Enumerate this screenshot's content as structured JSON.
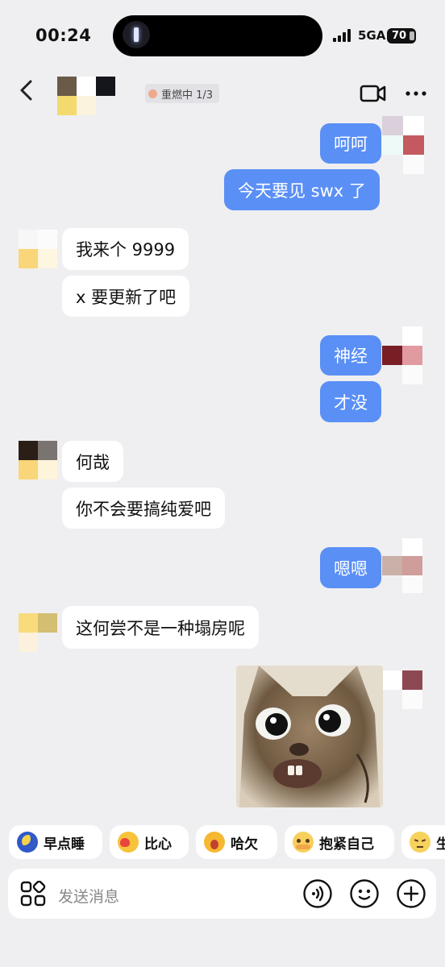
{
  "status_bar": {
    "time": "00:24",
    "network": "5GA",
    "battery": "70"
  },
  "header": {
    "group_status": "重燃中 1/3"
  },
  "messages": [
    {
      "side": "me",
      "text": "呵呵"
    },
    {
      "side": "me",
      "text": "今天要见 swx 了"
    },
    {
      "side": "other",
      "text": "我来个 9999"
    },
    {
      "side": "other",
      "text": "x 要更新了吧"
    },
    {
      "side": "me",
      "text": "神经"
    },
    {
      "side": "me",
      "text": "才没"
    },
    {
      "side": "other",
      "text": "何哉"
    },
    {
      "side": "other",
      "text": "你不会要搞纯爱吧"
    },
    {
      "side": "me",
      "text": "嗯嗯"
    },
    {
      "side": "other",
      "text": "这何尝不是一种塌房呢"
    },
    {
      "side": "me",
      "type": "sticker"
    }
  ],
  "quick_replies": [
    {
      "emoji": "moon-icon",
      "label": "早点睡"
    },
    {
      "emoji": "heart-hands-icon",
      "label": "比心"
    },
    {
      "emoji": "yawn-icon",
      "label": "哈欠"
    },
    {
      "emoji": "self-hug-icon",
      "label": "抱紧自己"
    },
    {
      "emoji": "angry-face-icon",
      "label": "生"
    }
  ],
  "input": {
    "placeholder": "发送消息"
  },
  "colors": {
    "my_bubble": "#5a8ff6",
    "other_bubble": "#ffffff",
    "background": "#efeff1"
  }
}
